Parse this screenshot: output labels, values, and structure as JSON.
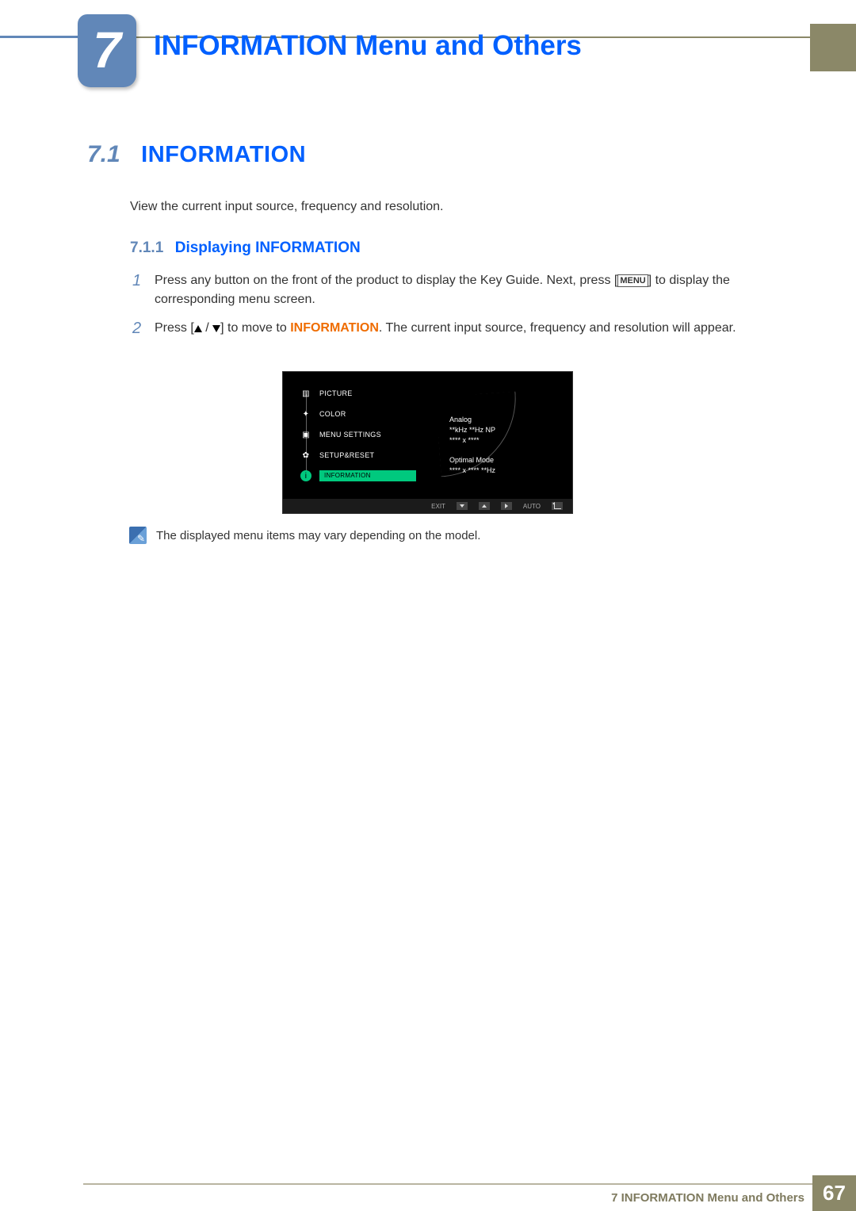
{
  "header": {
    "chapter_number": "7",
    "chapter_title": "INFORMATION Menu and Others"
  },
  "section": {
    "number": "7.1",
    "title": "INFORMATION",
    "intro": "View the current input source, frequency and resolution."
  },
  "subsection": {
    "number": "7.1.1",
    "title": "Displaying INFORMATION"
  },
  "steps": {
    "1": {
      "num": "1",
      "text_a": "Press any button on the front of the product to display the Key Guide. Next, press [",
      "menu_key": "MENU",
      "text_b": "] to display the corresponding menu screen."
    },
    "2": {
      "num": "2",
      "text_a": "Press [",
      "text_b": "] to move to ",
      "highlight": "INFORMATION",
      "text_c": ". The current input source, frequency and resolution will appear."
    }
  },
  "osd": {
    "items": {
      "picture": "PICTURE",
      "color": "COLOR",
      "menu_settings": "MENU SETTINGS",
      "setup_reset": "SETUP&RESET",
      "information": "INFORMATION"
    },
    "info": {
      "line1": "Analog",
      "line2": "**kHz **Hz NP",
      "line3": "**** x ****",
      "line4": "Optimal Mode",
      "line5": "**** x ****  **Hz"
    },
    "bottom": {
      "exit": "EXIT",
      "auto": "AUTO"
    }
  },
  "note": {
    "text": "The displayed menu items may vary depending on the model."
  },
  "footer": {
    "text": "7 INFORMATION Menu and Others",
    "page": "67"
  }
}
